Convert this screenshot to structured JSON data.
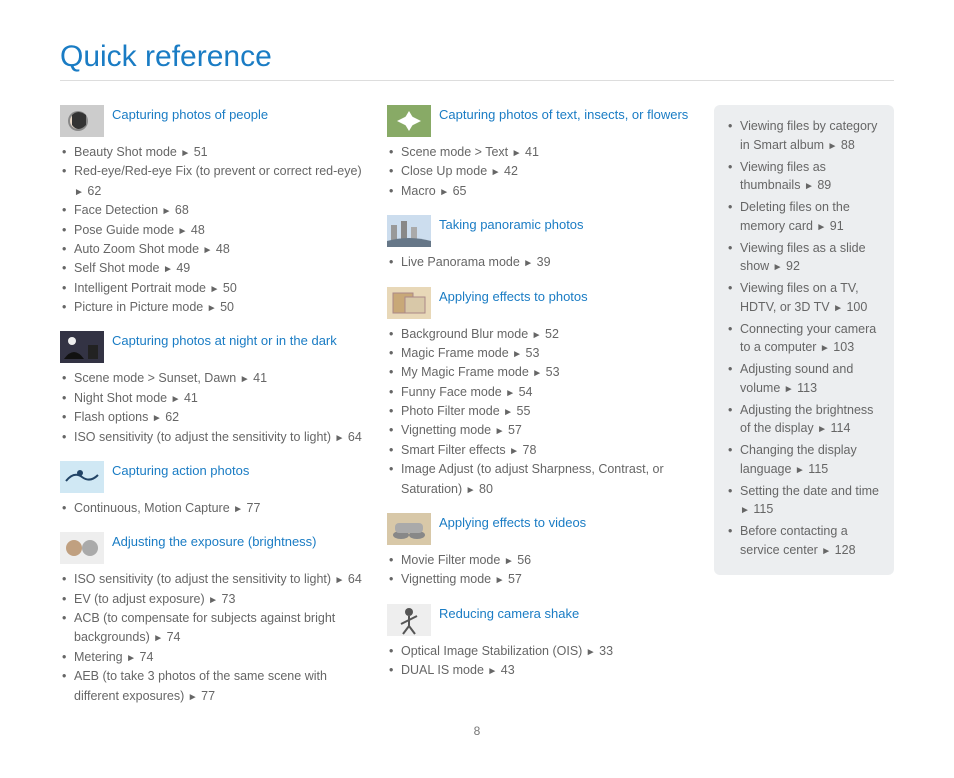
{
  "page_title": "Quick reference",
  "page_number": "8",
  "arrow": "►",
  "columns": [
    [
      {
        "title": "Capturing photos of people",
        "icon": "face-icon",
        "items": [
          {
            "text": "Beauty Shot mode",
            "page": "51"
          },
          {
            "text": "Red-eye/Red-eye Fix (to prevent or correct red-eye)",
            "page": "62"
          },
          {
            "text": "Face Detection",
            "page": "68"
          },
          {
            "text": "Pose Guide mode",
            "page": "48"
          },
          {
            "text": "Auto Zoom Shot mode",
            "page": "48"
          },
          {
            "text": "Self Shot mode",
            "page": "49"
          },
          {
            "text": "Intelligent Portrait mode",
            "page": "50"
          },
          {
            "text": "Picture in Picture mode",
            "page": "50"
          }
        ]
      },
      {
        "title": "Capturing photos at night or in the dark",
        "icon": "night-icon",
        "items": [
          {
            "text": "Scene mode > Sunset, Dawn",
            "page": "41"
          },
          {
            "text": "Night Shot mode",
            "page": "41"
          },
          {
            "text": "Flash options",
            "page": "62"
          },
          {
            "text": "ISO sensitivity (to adjust the sensitivity to light)",
            "page": "64"
          }
        ]
      },
      {
        "title": "Capturing action photos",
        "icon": "action-icon",
        "items": [
          {
            "text": "Continuous, Motion Capture",
            "page": "77"
          }
        ]
      },
      {
        "title": "Adjusting the exposure (brightness)",
        "icon": "exposure-icon",
        "items": [
          {
            "text": "ISO sensitivity (to adjust the sensitivity to light)",
            "page": "64"
          },
          {
            "text": "EV (to adjust exposure)",
            "page": "73"
          },
          {
            "text": "ACB (to compensate for subjects against bright backgrounds)",
            "page": "74"
          },
          {
            "text": "Metering",
            "page": "74"
          },
          {
            "text": "AEB (to take 3 photos of the same scene with different exposures)",
            "page": "77"
          }
        ]
      }
    ],
    [
      {
        "title": "Capturing  photos of text, insects, or flowers",
        "icon": "flower-icon",
        "items": [
          {
            "text": "Scene mode > Text",
            "page": "41"
          },
          {
            "text": "Close Up mode",
            "page": "42"
          },
          {
            "text": "Macro",
            "page": "65"
          }
        ]
      },
      {
        "title": "Taking panoramic photos",
        "icon": "panorama-icon",
        "items": [
          {
            "text": "Live Panorama mode",
            "page": "39"
          }
        ]
      },
      {
        "title": "Applying effects to photos",
        "icon": "photoeffect-icon",
        "items": [
          {
            "text": "Background Blur mode",
            "page": "52"
          },
          {
            "text": "Magic Frame mode",
            "page": "53"
          },
          {
            "text": "My Magic Frame mode",
            "page": "53"
          },
          {
            "text": "Funny Face mode",
            "page": "54"
          },
          {
            "text": "Photo Filter mode",
            "page": "55"
          },
          {
            "text": "Vignetting mode",
            "page": "57"
          },
          {
            "text": "Smart Filter effects",
            "page": "78"
          },
          {
            "text": "Image Adjust (to adjust Sharpness, Contrast, or Saturation)",
            "page": "80"
          }
        ]
      },
      {
        "title": "Applying effects to videos",
        "icon": "videoeffect-icon",
        "items": [
          {
            "text": "Movie Filter mode",
            "page": "56"
          },
          {
            "text": "Vignetting mode",
            "page": "57"
          }
        ]
      },
      {
        "title": "Reducing camera shake",
        "icon": "shake-icon",
        "items": [
          {
            "text": "Optical Image Stabilization (OIS)",
            "page": "33"
          },
          {
            "text": "DUAL IS mode",
            "page": "43"
          }
        ]
      }
    ]
  ],
  "sidebar": [
    {
      "text": "Viewing files by category in Smart album",
      "page": "88"
    },
    {
      "text": "Viewing files as thumbnails",
      "page": "89"
    },
    {
      "text": "Deleting files on the memory card",
      "page": "91"
    },
    {
      "text": "Viewing files as a slide show",
      "page": "92"
    },
    {
      "text": "Viewing files on a TV, HDTV, or 3D TV",
      "page": "100"
    },
    {
      "text": "Connecting your camera to a computer",
      "page": "103"
    },
    {
      "text": "Adjusting sound and volume",
      "page": "113"
    },
    {
      "text": "Adjusting the brightness of the display",
      "page": "114"
    },
    {
      "text": "Changing the display language",
      "page": "115"
    },
    {
      "text": "Setting the date and time",
      "page": "115"
    },
    {
      "text": "Before contacting a service center",
      "page": "128"
    }
  ],
  "icons": {
    "face-icon": "<svg viewBox='0 0 44 32'><rect width='44' height='32' fill='#ccc'/><circle cx='18' cy='16' r='10' fill='#888'/><circle cx='18' cy='16' r='8' fill='#e8d8c8'/><path d='M12 10 Q18 4 26 10 L26 20 Q18 28 12 20 Z' fill='#333'/></svg>",
    "night-icon": "<svg viewBox='0 0 44 32'><rect width='44' height='32' fill='#334'/><circle cx='12' cy='10' r='4' fill='#eee'/><path d='M4 28 Q14 14 24 28 Z' fill='#111'/><rect x='28' y='14' width='10' height='14' fill='#222'/></svg>",
    "action-icon": "<svg viewBox='0 0 44 32'><rect width='44' height='32' fill='#d0e8f4'/><path d='M6 20 Q14 10 22 16 Q30 22 38 14' stroke='#246' stroke-width='2' fill='none'/><circle cx='20' cy='12' r='3' fill='#246'/></svg>",
    "exposure-icon": "<svg viewBox='0 0 44 32'><rect width='44' height='32' fill='#eee'/><circle cx='14' cy='16' r='8' fill='#c0a080'/><circle cx='30' cy='16' r='8' fill='#aaa'/></svg>",
    "flower-icon": "<svg viewBox='0 0 44 32'><rect width='44' height='32' fill='#8a6'/><path d='M22 6 L28 16 L22 26 L16 16 Z' fill='#fff'/><path d='M10 16 L22 10 L34 16 L22 22 Z' fill='#fff'/></svg>",
    "panorama-icon": "<svg viewBox='0 0 44 32'><rect width='44' height='32' fill='#cde'/><rect x='4' y='10' width='6' height='18' fill='#999'/><rect x='14' y='6' width='6' height='22' fill='#888'/><rect x='24' y='12' width='6' height='16' fill='#aaa'/><path d='M0 26 Q22 20 44 26 L44 32 L0 32 Z' fill='#678'/></svg>",
    "photoeffect-icon": "<svg viewBox='0 0 44 32'><rect width='44' height='32' fill='#e8d8b8'/><rect x='6' y='6' width='20' height='20' fill='#c8a878' stroke='#a88' stroke-width='1'/><rect x='18' y='10' width='20' height='16' fill='#d8c8a8' stroke='#a88' stroke-width='1'/></svg>",
    "videoeffect-icon": "<svg viewBox='0 0 44 32'><rect width='44' height='32' fill='#d8c8a8'/><ellipse cx='14' cy='22' rx='8' ry='4' fill='#888'/><ellipse cx='30' cy='22' rx='8' ry='4' fill='#888'/><rect x='8' y='10' width='28' height='10' rx='4' fill='#aaa'/></svg>",
    "shake-icon": "<svg viewBox='0 0 44 32'><rect width='44' height='32' fill='#eee'/><circle cx='22' cy='8' r='4' fill='#555'/><path d='M22 12 L22 22 M22 16 L14 20 M22 16 L30 12 M22 22 L16 30 M22 22 L28 30' stroke='#555' stroke-width='2' fill='none'/></svg>"
  }
}
